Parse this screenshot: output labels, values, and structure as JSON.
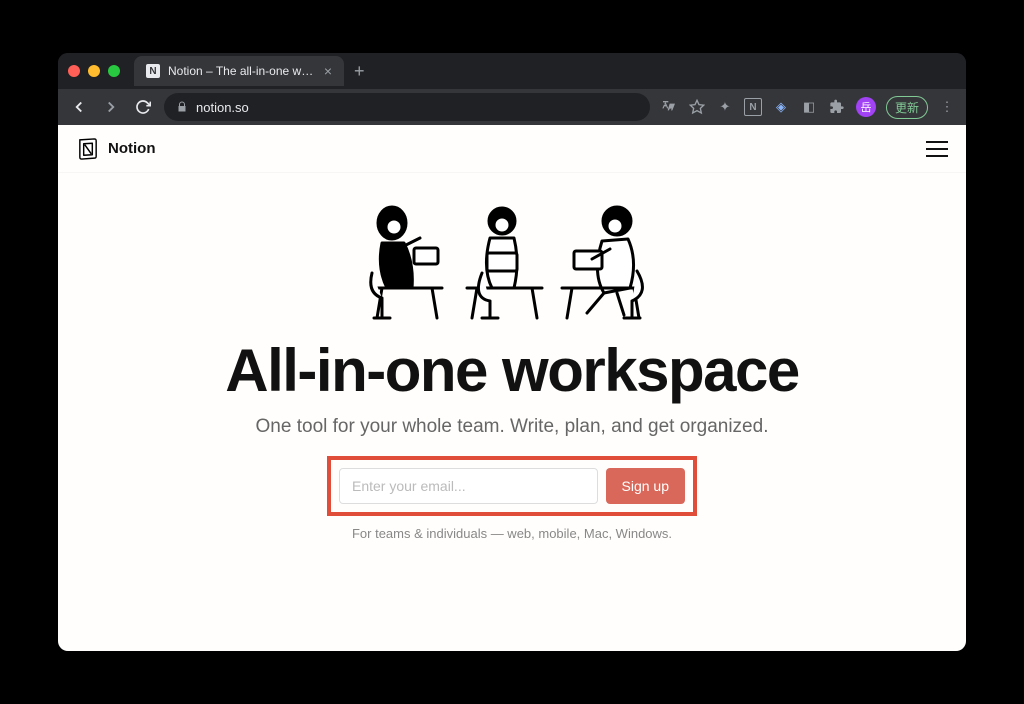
{
  "browser": {
    "tab_title": "Notion – The all-in-one worksp",
    "url": "notion.so",
    "update_label": "更新",
    "avatar_initial": "岳"
  },
  "header": {
    "brand": "Notion"
  },
  "hero": {
    "headline": "All-in-one workspace",
    "subtitle": "One tool for your whole team. Write, plan, and get organized.",
    "email_placeholder": "Enter your email...",
    "signup_label": "Sign up",
    "finetext": "For teams & individuals — web, mobile, Mac, Windows."
  }
}
